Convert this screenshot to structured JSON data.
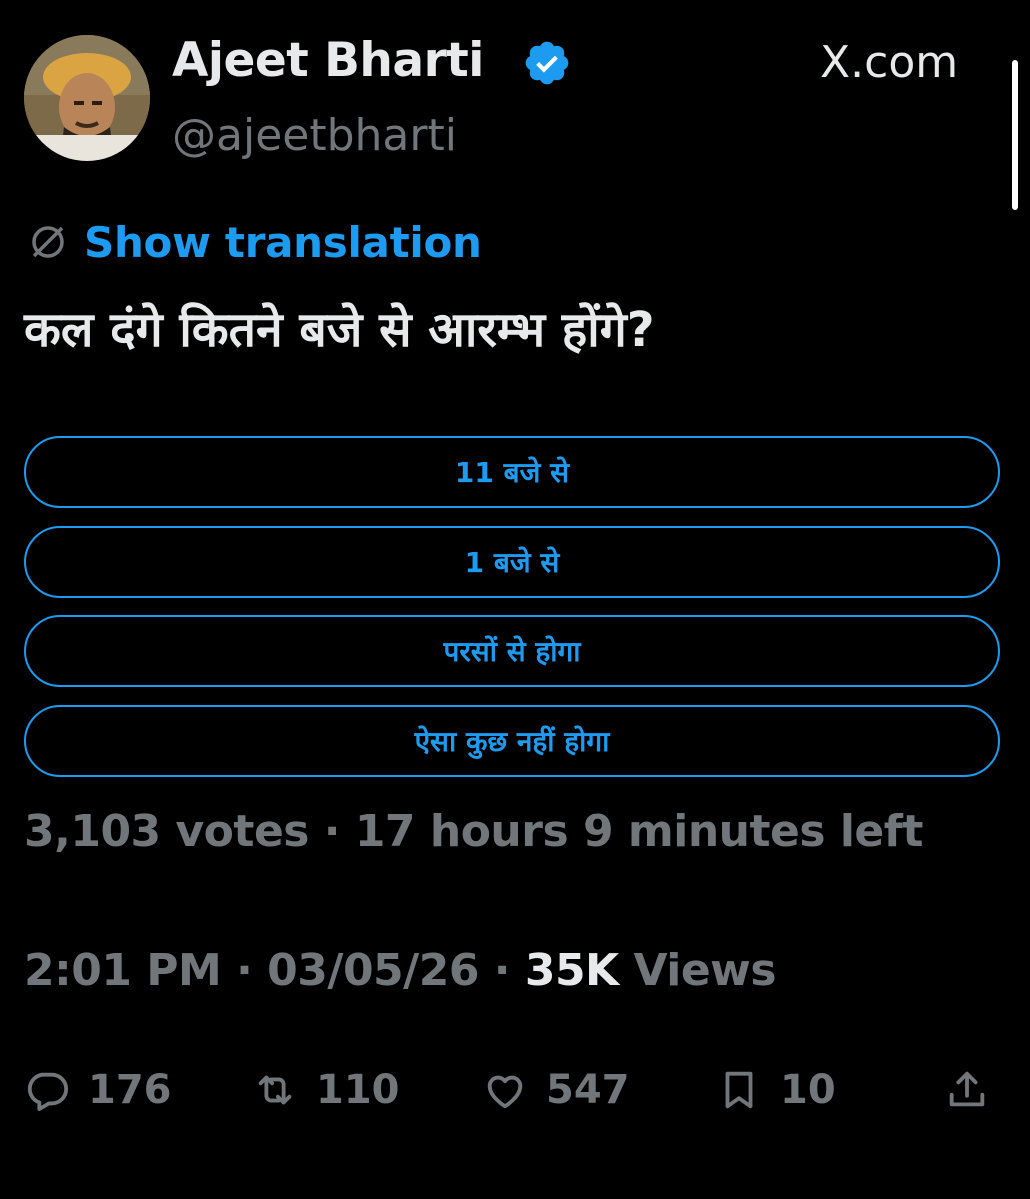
{
  "user": {
    "name": "Ajeet Bharti",
    "handle": "@ajeetbharti"
  },
  "site": {
    "label": "X.com"
  },
  "translation": {
    "link_text": "Show translation"
  },
  "tweet": {
    "text": "कल दंगे कितने बजे से आरम्भ होंगे?"
  },
  "poll": {
    "options": [
      {
        "label": "11 बजे से"
      },
      {
        "label": "1 बजे से"
      },
      {
        "label": "परसों से होगा"
      },
      {
        "label": "ऐसा कुछ नहीं होगा"
      }
    ],
    "meta": "3,103 votes · 17 hours 9 minutes left"
  },
  "footer": {
    "time": "2:01 PM · 03/05/26 · ",
    "views_count": "35K",
    "views_label": " Views"
  },
  "actions": {
    "replies": "176",
    "reposts": "110",
    "likes": "547",
    "bookmarks": "10"
  },
  "colors": {
    "accent": "#1d9bf0",
    "background": "#000000",
    "muted": "#71767b",
    "text": "#e7e9ea"
  }
}
